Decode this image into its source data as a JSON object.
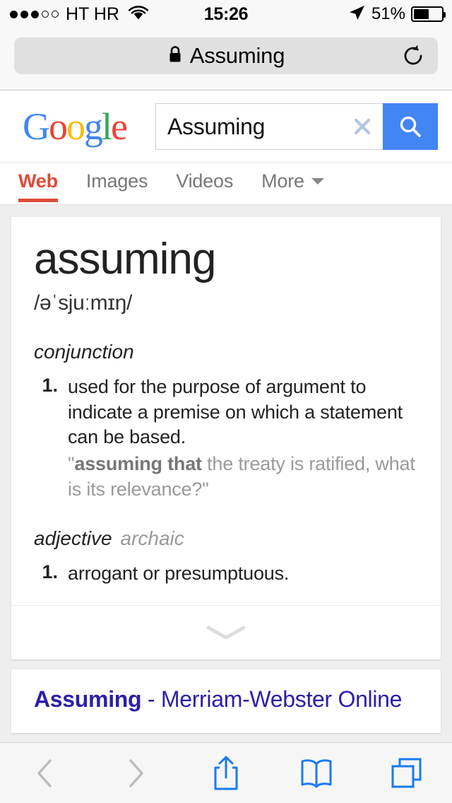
{
  "status_bar": {
    "carrier": "HT HR",
    "time": "15:26",
    "battery_percent": "51%",
    "signal_filled": 3,
    "signal_total": 5,
    "wifi_icon": "wifi-icon",
    "location_icon": "location-arrow-icon",
    "battery_icon": "battery-icon"
  },
  "browser": {
    "url_text": "Assuming",
    "lock_icon": "lock-icon",
    "reload_icon": "reload-icon",
    "toolbar": {
      "back_icon": "back-chevron-icon",
      "forward_icon": "forward-chevron-icon",
      "share_icon": "share-icon",
      "bookmarks_icon": "book-icon",
      "tabs_icon": "tabs-icon"
    }
  },
  "google": {
    "logo": {
      "letters": "Google",
      "colors": {
        "blue": "#4285f4",
        "red": "#ea4335",
        "yellow": "#fbbc05",
        "green": "#34a853"
      }
    },
    "search": {
      "value": "Assuming",
      "placeholder": "Search",
      "clear_icon": "clear-x-icon",
      "search_icon": "search-icon",
      "button_color": "#4285f4"
    },
    "tabs": [
      {
        "label": "Web",
        "active": true
      },
      {
        "label": "Images",
        "active": false
      },
      {
        "label": "Videos",
        "active": false
      },
      {
        "label": "More",
        "active": false,
        "has_caret": true
      }
    ],
    "active_tab_color": "#dd4b39"
  },
  "dictionary": {
    "word": "assuming",
    "phonetic": "/əˈsjuːmɪŋ/",
    "entries": [
      {
        "part_of_speech": "conjunction",
        "register": "",
        "senses": [
          {
            "number": "1.",
            "definition": "used for the purpose of argument to indicate a premise on which a statement can be based.",
            "example_prefix": "\"",
            "example_bold": "assuming that",
            "example_rest": " the treaty is ratified, what is its relevance?\""
          }
        ]
      },
      {
        "part_of_speech": "adjective",
        "register": "archaic",
        "senses": [
          {
            "number": "1.",
            "definition": "arrogant or presumptuous.",
            "example_prefix": "",
            "example_bold": "",
            "example_rest": ""
          }
        ]
      }
    ],
    "expand_icon": "chevron-down-icon"
  },
  "results": [
    {
      "title_bold": "Assuming",
      "title_rest": " - Merriam-Webster Online",
      "link_color": "#2b20a8"
    }
  ]
}
